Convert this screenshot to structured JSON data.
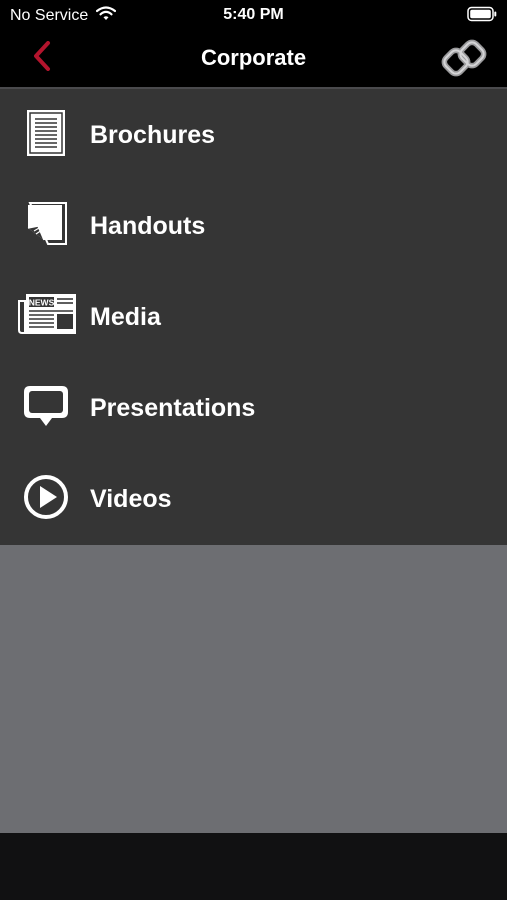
{
  "status_bar": {
    "carrier": "No Service",
    "time": "5:40 PM",
    "icons": [
      "wifi-icon",
      "battery-icon"
    ]
  },
  "nav": {
    "title": "Corporate",
    "back_icon": "chevron-left-icon",
    "logo_icon": "linked-rings-logo",
    "accent_color": "#b3142d"
  },
  "menu": {
    "items": [
      {
        "label": "Brochures",
        "icon": "document-icon"
      },
      {
        "label": "Handouts",
        "icon": "page-curl-icon"
      },
      {
        "label": "Media",
        "icon": "newspaper-icon"
      },
      {
        "label": "Presentations",
        "icon": "speech-bubble-icon"
      },
      {
        "label": "Videos",
        "icon": "play-circle-icon"
      }
    ],
    "newspaper_text": "NEWS"
  },
  "colors": {
    "menu_background": "#353535",
    "empty_background": "#6d6e72",
    "bar_background": "#000000"
  }
}
